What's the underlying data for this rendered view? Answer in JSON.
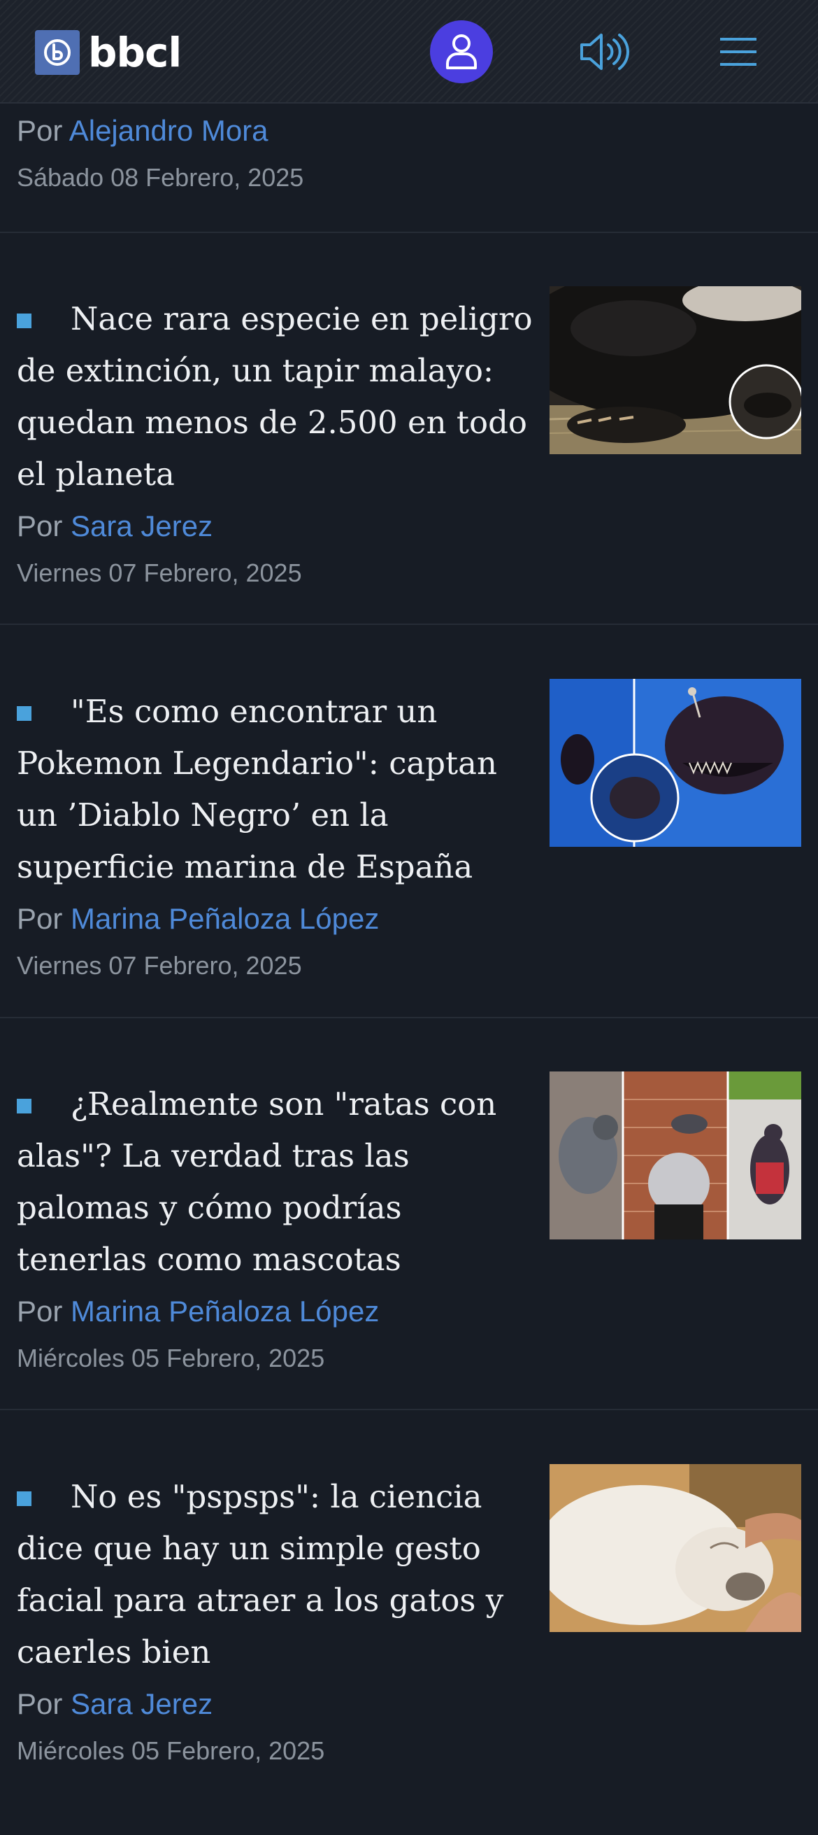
{
  "header": {
    "logo_text": "bbcl",
    "icons": {
      "logo": "bbcl-logo-icon",
      "user": "user-icon",
      "audio": "speaker-icon",
      "menu": "hamburger-menu-icon"
    },
    "colors": {
      "user_button": "#4b3ee0",
      "accent": "#4aa2dc",
      "author_link": "#4f8ad9"
    }
  },
  "top_meta": {
    "by": "Por",
    "author": "Alejandro Mora",
    "date": "Sábado 08 Febrero, 2025"
  },
  "articles": [
    {
      "title": "Nace rara especie en peligro de extinción, un tapir malayo: quedan menos de 2.500 en todo el planeta",
      "by": "Por",
      "author": "Sara Jerez",
      "date": "Viernes 07 Febrero, 2025"
    },
    {
      "title": "\"Es como encontrar un Pokemon Legendario\": captan un ’Diablo Negro’ en la superficie marina de España",
      "by": "Por",
      "author": "Marina Peñaloza López",
      "date": "Viernes 07 Febrero, 2025"
    },
    {
      "title": "¿Realmente son \"ratas con alas\"? La verdad tras las palomas y cómo podrías tenerlas como mascotas",
      "by": "Por",
      "author": "Marina Peñaloza López",
      "date": "Miércoles 05 Febrero, 2025"
    },
    {
      "title": "No es \"pspsps\": la ciencia dice que hay un simple gesto facial para atraer a los gatos y caerles bien",
      "by": "Por",
      "author": "Sara Jerez",
      "date": "Miércoles 05 Febrero, 2025"
    }
  ]
}
